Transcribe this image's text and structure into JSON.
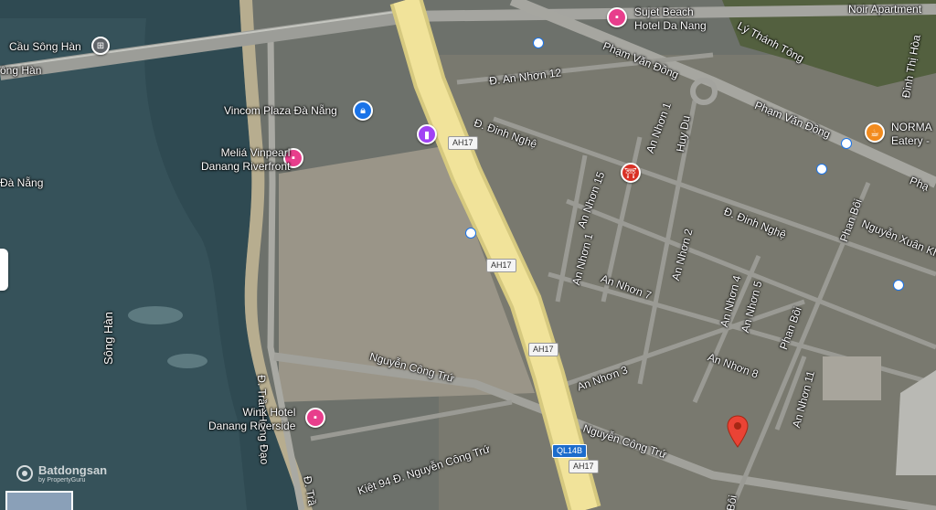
{
  "labels": {
    "bridge": "Cầu Sông Hàn",
    "bridge_road": "ông Hàn",
    "city_left": "Đà Nẵng",
    "river": "Sông Hàn",
    "noir": "Noir Apartment",
    "an_nhon_12": "Đ. An Nhơn 12",
    "pham_van_dong_1": "Phạm Văn Đồng",
    "pham_van_dong_2": "Phạm Văn Đồng",
    "pham_right": "Phạ",
    "ly_thanh_tong": "Lý Thánh Tông",
    "dinh_thi_hoa": "Đinh Thị Hòa",
    "an_nhon_1_top": "An Nhơn 1",
    "huy_du": "Huy Du",
    "dinh_nghe_top": "Đ. Đinh Nghệ",
    "dinh_nghe_mid": "Đ. Đinh Nghệ",
    "an_nhon_15": "An Nhơn 15",
    "an_nhon_1_mid": "An Nhơn 1",
    "an_nhon_2": "An Nhơn 2",
    "an_nhon_7": "An Nhơn 7",
    "an_nhon_4": "An Nhơn 4",
    "an_nhon_5": "An Nhơn 5",
    "phan_boi_top": "Phan Bôi",
    "phan_boi_mid": "Phan Bôi",
    "phan_boi_bottom": "Bôi",
    "nguyen_xuan": "Nguyễn Xuân Kh",
    "an_nhon_3": "An Nhơn 3",
    "an_nhon_8": "An Nhơn 8",
    "an_nhon_11": "An Nhơn 11",
    "tran_hung_dao": "Đ. Trần Hưng Đạo",
    "tran_bottom": "Đ. Trầ",
    "nguyen_cong_tru_1": "Nguyễn Công Trứ",
    "nguyen_cong_tru_2": "Nguyễn Công Trứ",
    "kiet_94": "Kiệt 94 Đ. Nguyễn Công Trứ"
  },
  "pois": {
    "sujet_beach": "Sujet Beach\nHotel Da Nang",
    "vincom": "Vincom Plaza Đà Nẵng",
    "melia": "Meliá Vinpearl\nDanang Riverfront",
    "wink": "Wink Hotel\nDanang Riverside",
    "norma": "NORMA\nEatery -"
  },
  "shields": {
    "ah17_1": "AH17",
    "ah17_2": "AH17",
    "ah17_3": "AH17",
    "ah17_4": "AH17",
    "ql14b": "QL14B"
  },
  "watermark": {
    "brand": "Batdongsan",
    "sub": "by PropertyGuru"
  },
  "colors": {
    "hotel": "#e83e8c",
    "shopping": "#1a73e8",
    "restaurant": "#f28b1e",
    "landmark": "#d93025",
    "marker": "#ea4335",
    "highway": "#f1e39a"
  }
}
